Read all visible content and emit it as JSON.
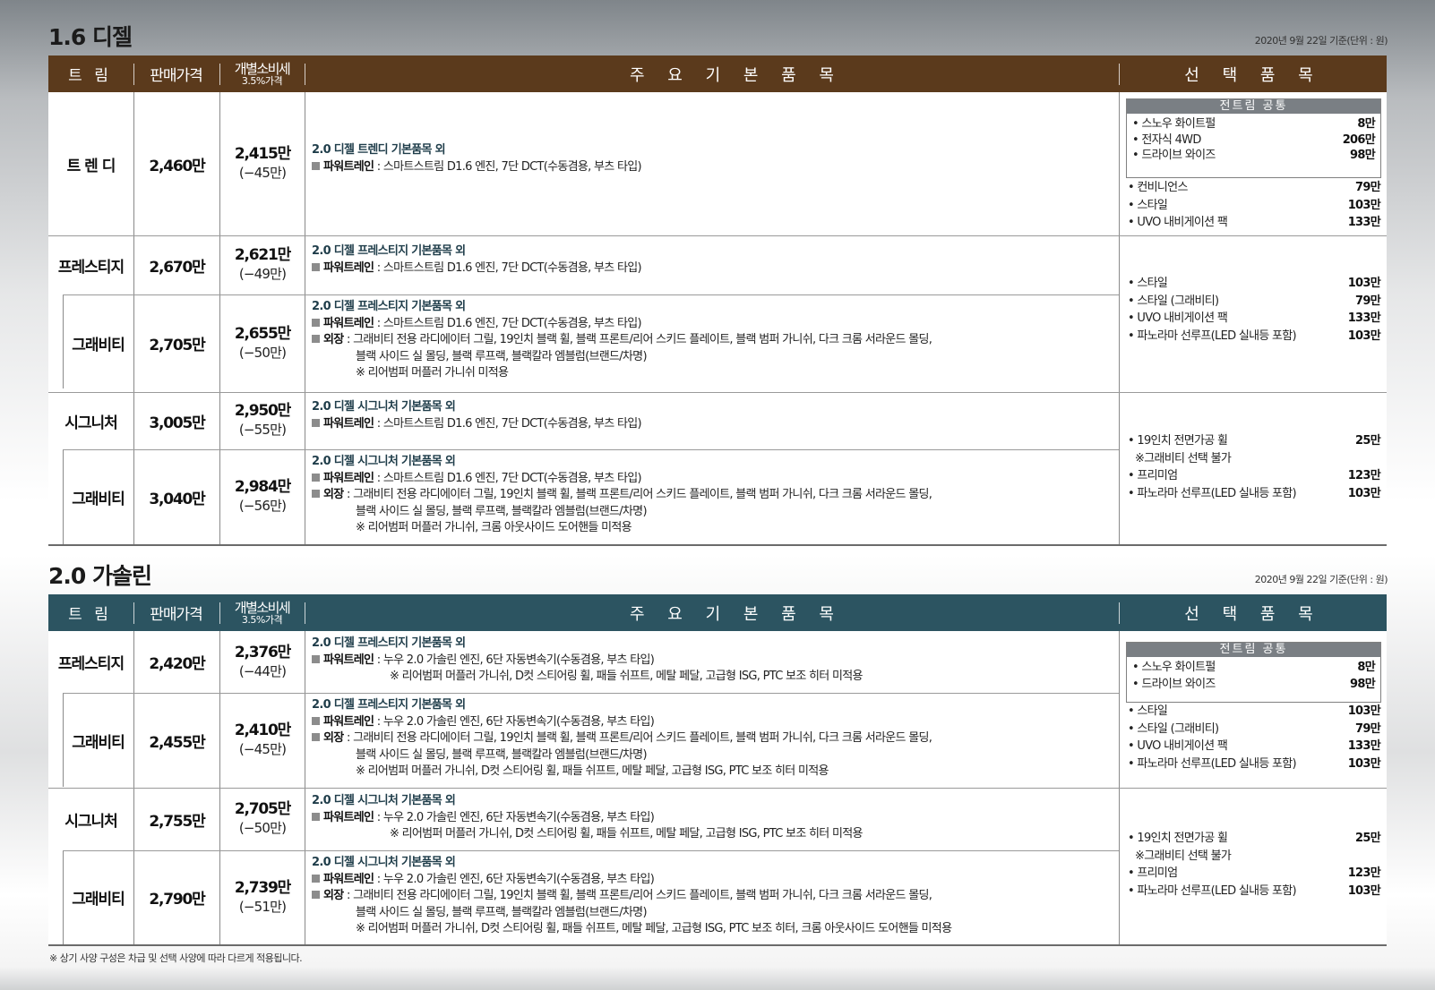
{
  "colors": {
    "diesel_header": "#5b3a1c",
    "gasoline_header": "#2c5461"
  },
  "headers": {
    "trim": "트 림",
    "price": "판매가격",
    "tax_line1": "개별소비세",
    "tax_line2": "3.5%가격",
    "main": "주 요 기 본 품 목",
    "options": "선 택 품 목"
  },
  "diesel": {
    "title": "1.6 디젤",
    "basis": "2020년 9월 22일 기준(단위 : 원)",
    "rows": [
      {
        "trim": "트 렌 디",
        "price": "2,460만",
        "tax": "2,415만",
        "disc": "(−45만)",
        "f1": "2.0 디젤 트렌디 기본품목 외",
        "pt_label": "파워트레인",
        "pt_text": " : 스마트스트림 D1.6 엔진, 7단 DCT(수동겸용, 부츠 타입)"
      },
      {
        "trim": "프레스티지",
        "price": "2,670만",
        "tax": "2,621만",
        "disc": "(−49만)",
        "f1": "2.0 디젤 프레스티지 기본품목 외",
        "pt_label": "파워트레인",
        "pt_text": " : 스마트스트림 D1.6 엔진, 7단 DCT(수동겸용, 부츠 타입)"
      },
      {
        "trim": "그래비티",
        "price": "2,705만",
        "tax": "2,655만",
        "disc": "(−50만)",
        "f1": "2.0 디젤 프레스티지 기본품목 외",
        "pt_label": "파워트레인",
        "pt_text": " : 스마트스트림 D1.6 엔진, 7단 DCT(수동겸용, 부츠 타입)",
        "ext_label": "외장",
        "ext1": " : 그래비티 전용 라디에이터 그릴, 19인치 블랙 휠,  블랙 프론트/리어 스키드 플레이트, 블랙 범퍼 가니쉬, 다크 크롬 서라운드 몰딩,",
        "ext2": "블랙 사이드 실 몰딩, 블랙 루프랙, 블랙칼라 엠블럼(브랜드/차명)",
        "ext3": "※ 리어범퍼  머플러 가니쉬 미적용"
      },
      {
        "trim": "시그니처",
        "price": "3,005만",
        "tax": "2,950만",
        "disc": "(−55만)",
        "f1": "2.0 디젤 시그니처 기본품목 외",
        "pt_label": "파워트레인",
        "pt_text": " : 스마트스트림 D1.6 엔진, 7단 DCT(수동겸용, 부츠 타입)"
      },
      {
        "trim": "그래비티",
        "price": "3,040만",
        "tax": "2,984만",
        "disc": "(−56만)",
        "f1": "2.0 디젤 시그니처 기본품목 외",
        "pt_label": "파워트레인",
        "pt_text": " : 스마트스트림 D1.6 엔진, 7단 DCT(수동겸용, 부츠 타입)",
        "ext_label": "외장",
        "ext1": " : 그래비티 전용 라디에이터 그릴, 19인치 블랙 휠,  블랙 프론트/리어 스키드 플레이트, 블랙 범퍼 가니쉬, 다크 크롬 서라운드 몰딩,",
        "ext2": "블랙 사이드 실 몰딩, 블랙 루프랙, 블랙칼라 엠블럼(브랜드/차명)",
        "ext3": "※ 리어범퍼  머플러 가니쉬, 크롬 아웃사이드 도어핸들 미적용"
      }
    ],
    "common_caption": "전트림 공통",
    "common": [
      {
        "name": "• 스노우 화이트펄",
        "price": "8만"
      },
      {
        "name": "• 전자식 4WD",
        "price": "206만"
      },
      {
        "name": "• 드라이브 와이즈",
        "price": "98만"
      }
    ],
    "opt_trendy": [
      {
        "name": "• 컨비니언스",
        "price": "79만"
      },
      {
        "name": "• 스타일",
        "price": "103만"
      },
      {
        "name": "• UVO 내비게이션 팩",
        "price": "133만"
      }
    ],
    "opt_prestige": [
      {
        "name": "• 스타일",
        "price": "103만"
      },
      {
        "name": "• 스타일 (그래비티)",
        "price": "79만"
      },
      {
        "name": "• UVO 내비게이션 팩",
        "price": "133만"
      },
      {
        "name": "• 파노라마 선루프(LED 실내등 포함)",
        "price": "103만"
      }
    ],
    "opt_signature": [
      {
        "name": "• 19인치 전면가공 휠",
        "price": "25만"
      },
      {
        "name": "   ※그래비티 선택 불가",
        "price": ""
      },
      {
        "name": "• 프리미엄",
        "price": "123만"
      },
      {
        "name": "• 파노라마 선루프(LED 실내등 포함)",
        "price": "103만"
      }
    ]
  },
  "gasoline": {
    "title": "2.0 가솔린",
    "basis": "2020년 9월 22일 기준(단위 : 원)",
    "rows": [
      {
        "trim": "프레스티지",
        "price": "2,420만",
        "tax": "2,376만",
        "disc": "(−44만)",
        "f1": "2.0 디젤 프레스티지 기본품목 외",
        "pt_label": "파워트레인",
        "pt_text": " : 누우 2.0 가솔린 엔진, 6단 자동변속기(수동겸용, 부츠 타입)",
        "note": "※ 리어범퍼 머플러 가니쉬, D컷 스티어링 휠, 패들 쉬프트, 메탈 페달, 고급형 ISG, PTC 보조 히터 미적용"
      },
      {
        "trim": "그래비티",
        "price": "2,455만",
        "tax": "2,410만",
        "disc": "(−45만)",
        "f1": "2.0 디젤 프레스티지 기본품목 외",
        "pt_label": "파워트레인",
        "pt_text": " : 누우 2.0 가솔린 엔진, 6단 자동변속기(수동겸용, 부츠 타입)",
        "ext_label": "외장",
        "ext1": " : 그래비티 전용 라디에이터 그릴, 19인치 블랙 휠,  블랙 프론트/리어 스키드 플레이트, 블랙 범퍼 가니쉬, 다크 크롬 서라운드 몰딩,",
        "ext2": "블랙 사이드 실 몰딩, 블랙 루프랙, 블랙칼라 엠블럼(브랜드/차명)",
        "ext3": "※ 리어범퍼 머플러 가니쉬, D컷 스티어링 휠, 패들 쉬프트, 메탈 페달, 고급형 ISG, PTC 보조 히터 미적용"
      },
      {
        "trim": "시그니처",
        "price": "2,755만",
        "tax": "2,705만",
        "disc": "(−50만)",
        "f1": "2.0 디젤 시그니처 기본품목 외",
        "pt_label": "파워트레인",
        "pt_text": " : 누우 2.0 가솔린 엔진, 6단 자동변속기(수동겸용, 부츠 타입)",
        "note": "※ 리어범퍼 머플러 가니쉬, D컷 스티어링 휠, 패들 쉬프트, 메탈 페달, 고급형 ISG, PTC 보조 히터 미적용"
      },
      {
        "trim": "그래비티",
        "price": "2,790만",
        "tax": "2,739만",
        "disc": "(−51만)",
        "f1": "2.0 디젤 시그니처 기본품목 외",
        "pt_label": "파워트레인",
        "pt_text": " : 누우 2.0 가솔린 엔진, 6단 자동변속기(수동겸용, 부츠 타입)",
        "ext_label": "외장",
        "ext1": " : 그래비티 전용 라디에이터 그릴, 19인치 블랙 휠,  블랙 프론트/리어 스키드 플레이트, 블랙 범퍼 가니쉬, 다크 크롬 서라운드 몰딩,",
        "ext2": "블랙 사이드 실 몰딩, 블랙 루프랙, 블랙칼라 엠블럼(브랜드/차명)",
        "ext3": "※ 리어범퍼 머플러 가니쉬, D컷 스티어링 휠, 패들 쉬프트, 메탈 페달, 고급형 ISG, PTC 보조 히터, 크롬 아웃사이드 도어핸들 미적용"
      }
    ],
    "common_caption": "전트림 공통",
    "common": [
      {
        "name": "• 스노우 화이트펄",
        "price": "8만"
      },
      {
        "name": "• 드라이브 와이즈",
        "price": "98만"
      }
    ],
    "opt_prestige": [
      {
        "name": "• 스타일",
        "price": "103만"
      },
      {
        "name": "• 스타일 (그래비티)",
        "price": "79만"
      },
      {
        "name": "• UVO 내비게이션 팩",
        "price": "133만"
      },
      {
        "name": "• 파노라마 선루프(LED 실내등 포함)",
        "price": "103만"
      }
    ],
    "opt_signature": [
      {
        "name": "• 19인치 전면가공 휠",
        "price": "25만"
      },
      {
        "name": "   ※그래비티 선택 불가",
        "price": ""
      },
      {
        "name": "• 프리미엄",
        "price": "123만"
      },
      {
        "name": "• 파노라마 선루프(LED 실내등 포함)",
        "price": "103만"
      }
    ]
  },
  "footnote": "※ 상기 사양 구성은 차급 및 선택 사양에 따라 다르게 적용됩니다."
}
